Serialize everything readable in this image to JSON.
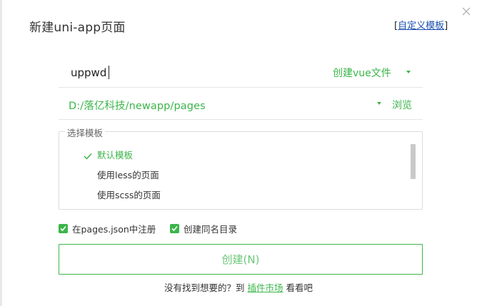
{
  "dialog": {
    "title": "新建uni-app页面",
    "custom_template": {
      "open": "[",
      "label": "自定义模板",
      "close": "]"
    }
  },
  "name_row": {
    "value": "uppwd",
    "type_label": "创建vue文件"
  },
  "path_row": {
    "value": "D:/落亿科技/newapp/pages",
    "browse_label": "浏览"
  },
  "templates": {
    "legend": "选择模板",
    "items": [
      "默认模板",
      "使用less的页面",
      "使用scss的页面"
    ],
    "selected_index": 0
  },
  "options": {
    "register_label": "在pages.json中注册",
    "register_checked": true,
    "samename_label": "创建同名目录",
    "samename_checked": true
  },
  "create_button": "创建(N)",
  "footer": {
    "prefix": "没有找到想要的？到",
    "market": "插件市场",
    "suffix": "看看吧"
  },
  "colors": {
    "accent": "#3bb54a",
    "link": "#1a4fb0"
  },
  "icons": {
    "close": "close-icon",
    "dropdown": "chevron-down-icon",
    "selected": "checkmark-icon",
    "checkbox": "checkbox-checked-icon"
  }
}
